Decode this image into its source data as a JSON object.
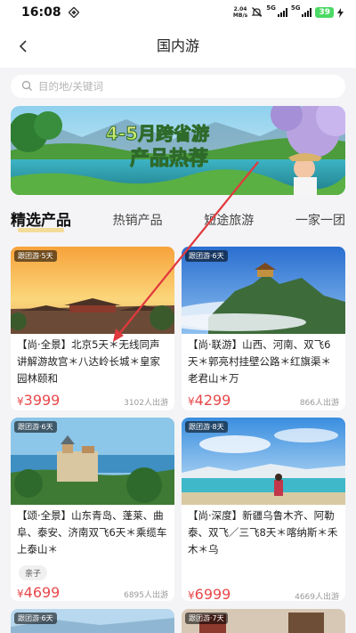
{
  "status_bar": {
    "time": "16:08",
    "net_speed_value": "2.04",
    "net_speed_unit": "MB/s",
    "signal1_label": "5G",
    "signal2_label": "5G",
    "battery": "39"
  },
  "nav": {
    "title": "国内游"
  },
  "search": {
    "placeholder": "目的地/关键词"
  },
  "banner": {
    "headline_line1": "4-5月跨省游",
    "headline_line2": "产品热荐"
  },
  "tabs": [
    "精选产品",
    "热销产品",
    "短途旅游",
    "一家一团"
  ],
  "products": [
    {
      "badge": "跟团游·5天",
      "title": "【尚·全景】北京5天＊无线同声讲解游故宫＊八达岭长城＊皇家园林颐和",
      "currency": "¥",
      "price": "3999",
      "sold": "3102人出游"
    },
    {
      "badge": "跟团游·6天",
      "title": "【尚·联游】山西、河南、双飞6天＊郭亮村挂壁公路＊红旗渠＊老君山＊万",
      "currency": "¥",
      "price": "4299",
      "sold": "866人出游"
    },
    {
      "badge": "跟团游·6天",
      "title": "【颂·全景】山东青岛、蓬莱、曲阜、泰安、济南双飞6天＊乘缆车上泰山＊",
      "tag": "亲子",
      "currency": "¥",
      "price": "4699",
      "sold": "6895人出游"
    },
    {
      "badge": "跟团游·8天",
      "title": "【尚·深度】新疆乌鲁木齐、阿勒泰、双飞／三飞8天＊喀纳斯＊禾木＊乌",
      "currency": "¥",
      "price": "6999",
      "sold": "4669人出游"
    },
    {
      "badge": "跟团游·6天"
    },
    {
      "badge": "跟团游·7天"
    }
  ],
  "colors": {
    "price": "#e8484b",
    "accent_tab": "#f2c94c",
    "annotation_arrow": "#e0393e"
  }
}
